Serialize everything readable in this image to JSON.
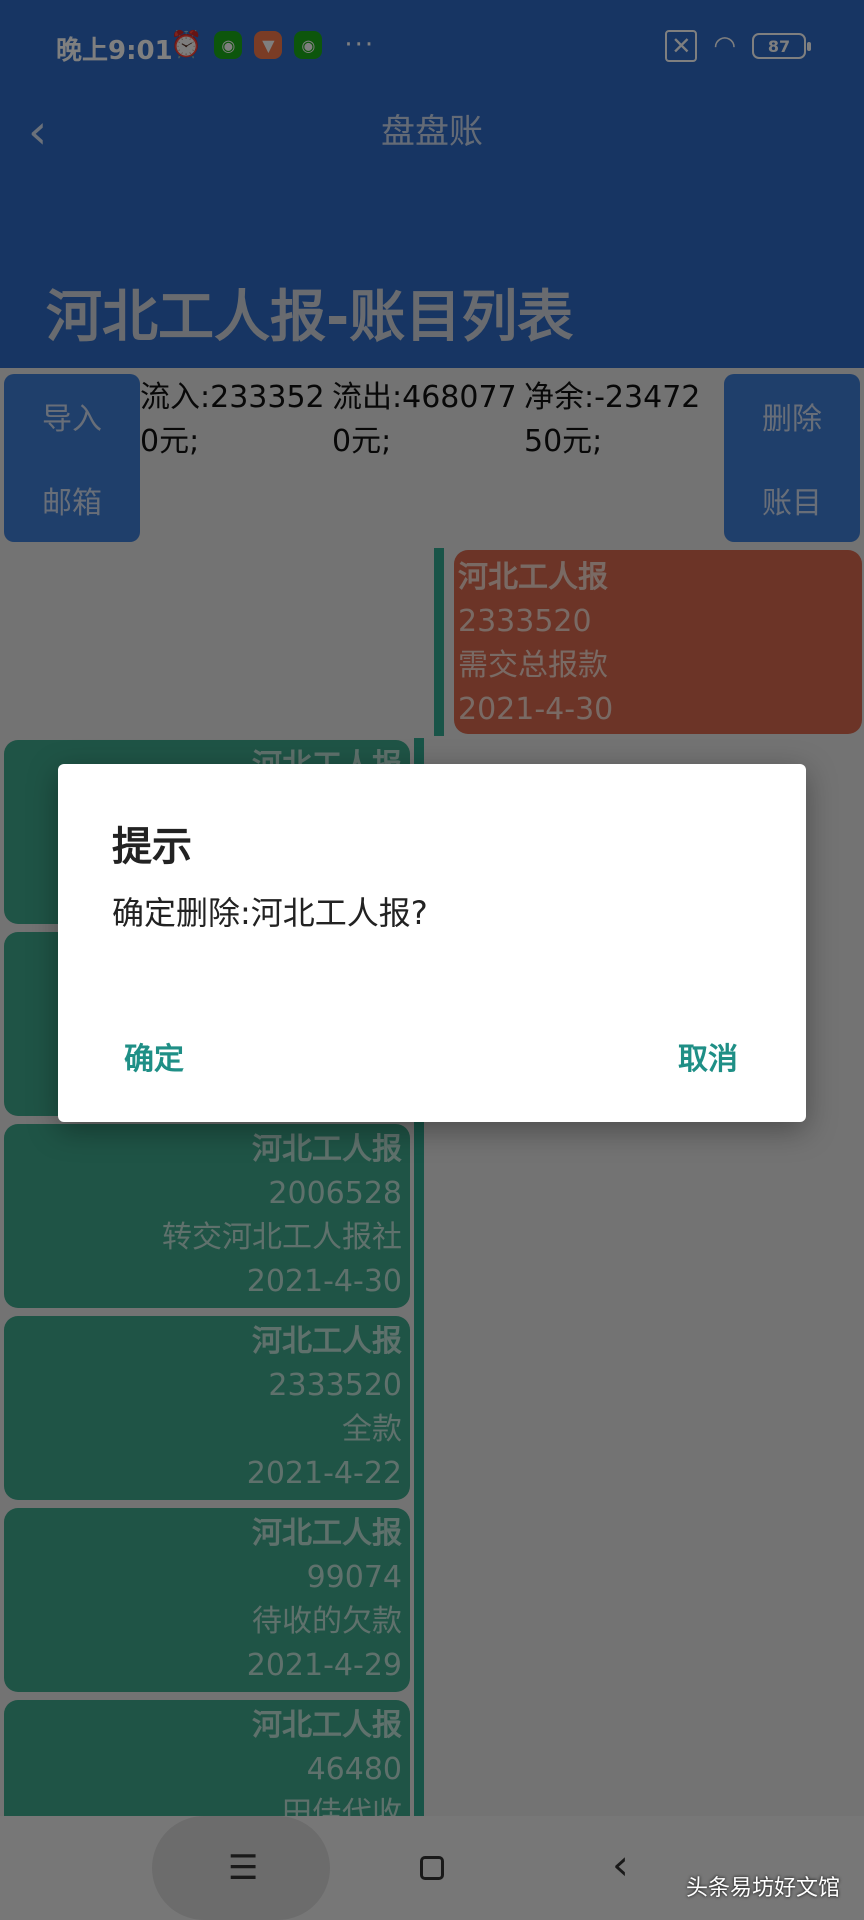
{
  "status_bar": {
    "time": "晚上9:01",
    "more": "···",
    "battery": "87"
  },
  "app_bar": {
    "back": "‹",
    "title": "盘盘账",
    "heading": "河北工人报-账目列表"
  },
  "toolbar": {
    "import_line1": "导入",
    "import_line2": "邮箱",
    "delete_line1": "删除",
    "delete_line2": "账目",
    "inflow": "流入:2333520元;",
    "outflow": "流出:4680770元;",
    "net": "净余:-2347250元;"
  },
  "entries": [
    {
      "title": "河北工人报",
      "amount": "2333520",
      "desc": "需交总报款",
      "date": "2021-4-30",
      "color": "#d9694f"
    },
    {
      "title": "河北工人报",
      "amount": "",
      "desc": "",
      "date": ""
    },
    {
      "title": "",
      "amount": "",
      "desc": "",
      "date": ""
    },
    {
      "title": "河北工人报",
      "amount": "2006528",
      "desc": "转交河北工人报社",
      "date": "2021-4-30"
    },
    {
      "title": "河北工人报",
      "amount": "2333520",
      "desc": "全款",
      "date": "2021-4-22"
    },
    {
      "title": "河北工人报",
      "amount": "99074",
      "desc": "待收的欠款",
      "date": "2021-4-29"
    },
    {
      "title": "河北工人报",
      "amount": "46480",
      "desc": "田佳代收",
      "date": ""
    }
  ],
  "dialog": {
    "title": "提示",
    "message": "确定删除:河北工人报?",
    "confirm": "确定",
    "cancel": "取消"
  },
  "nav": {
    "menu": "☰",
    "back": "‹"
  },
  "watermark": "头条易坊好文馆",
  "colors": {
    "primary": "#2f6bc6",
    "accent_green": "#3fa88d",
    "card_red": "#d9694f",
    "dialog_button": "#1f8f86"
  }
}
